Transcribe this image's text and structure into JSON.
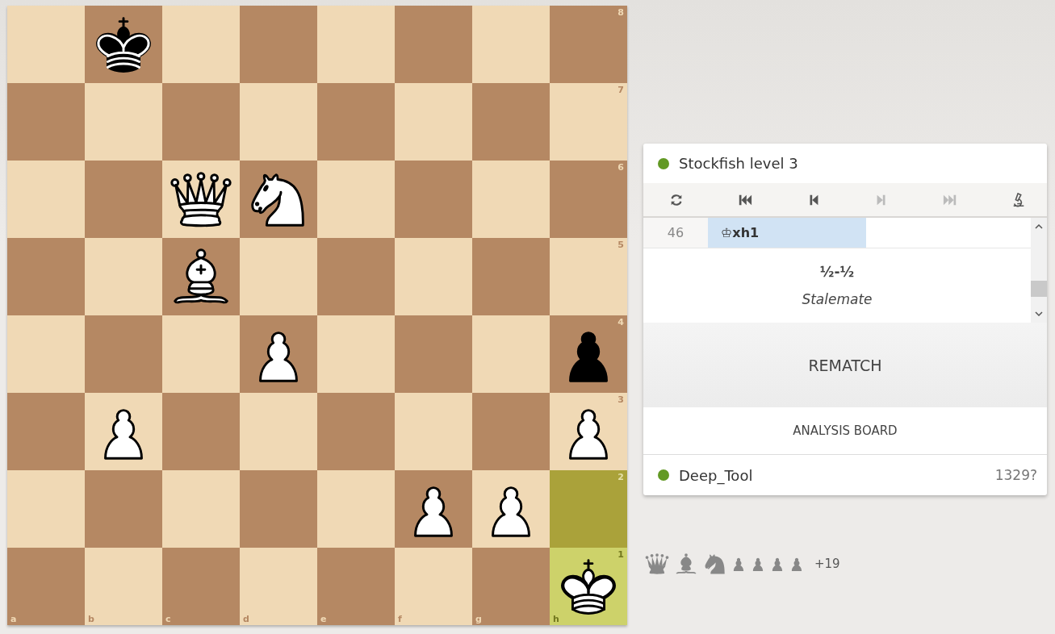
{
  "board": {
    "files": [
      "a",
      "b",
      "c",
      "d",
      "e",
      "f",
      "g",
      "h"
    ],
    "rows": [
      {
        "rank": "8",
        "squares": [
          {
            "kind": "empty",
            "highlighted": false
          },
          {
            "kind": "king",
            "black": true,
            "highlighted": false
          },
          {
            "kind": "empty",
            "highlighted": false
          },
          {
            "kind": "empty",
            "highlighted": false
          },
          {
            "kind": "empty",
            "highlighted": false
          },
          {
            "kind": "empty",
            "highlighted": false
          },
          {
            "kind": "empty",
            "highlighted": false
          },
          {
            "kind": "empty",
            "highlighted": false
          }
        ]
      },
      {
        "rank": "7",
        "squares": [
          {
            "kind": "empty",
            "highlighted": false
          },
          {
            "kind": "empty",
            "highlighted": false
          },
          {
            "kind": "empty",
            "highlighted": false
          },
          {
            "kind": "empty",
            "highlighted": false
          },
          {
            "kind": "empty",
            "highlighted": false
          },
          {
            "kind": "empty",
            "highlighted": false
          },
          {
            "kind": "empty",
            "highlighted": false
          },
          {
            "kind": "empty",
            "highlighted": false
          }
        ]
      },
      {
        "rank": "6",
        "squares": [
          {
            "kind": "empty",
            "highlighted": false
          },
          {
            "kind": "empty",
            "highlighted": false
          },
          {
            "kind": "queen",
            "black": false,
            "highlighted": false
          },
          {
            "kind": "knight",
            "black": false,
            "highlighted": false
          },
          {
            "kind": "empty",
            "highlighted": false
          },
          {
            "kind": "empty",
            "highlighted": false
          },
          {
            "kind": "empty",
            "highlighted": false
          },
          {
            "kind": "empty",
            "highlighted": false
          }
        ]
      },
      {
        "rank": "5",
        "squares": [
          {
            "kind": "empty",
            "highlighted": false
          },
          {
            "kind": "empty",
            "highlighted": false
          },
          {
            "kind": "bishop",
            "black": false,
            "highlighted": false
          },
          {
            "kind": "empty",
            "highlighted": false
          },
          {
            "kind": "empty",
            "highlighted": false
          },
          {
            "kind": "empty",
            "highlighted": false
          },
          {
            "kind": "empty",
            "highlighted": false
          },
          {
            "kind": "empty",
            "highlighted": false
          }
        ]
      },
      {
        "rank": "4",
        "squares": [
          {
            "kind": "empty",
            "highlighted": false
          },
          {
            "kind": "empty",
            "highlighted": false
          },
          {
            "kind": "empty",
            "highlighted": false
          },
          {
            "kind": "pawn",
            "black": false,
            "highlighted": false
          },
          {
            "kind": "empty",
            "highlighted": false
          },
          {
            "kind": "empty",
            "highlighted": false
          },
          {
            "kind": "empty",
            "highlighted": false
          },
          {
            "kind": "pawn",
            "black": true,
            "highlighted": false
          }
        ]
      },
      {
        "rank": "3",
        "squares": [
          {
            "kind": "empty",
            "highlighted": false
          },
          {
            "kind": "pawn",
            "black": false,
            "highlighted": false
          },
          {
            "kind": "empty",
            "highlighted": false
          },
          {
            "kind": "empty",
            "highlighted": false
          },
          {
            "kind": "empty",
            "highlighted": false
          },
          {
            "kind": "empty",
            "highlighted": false
          },
          {
            "kind": "empty",
            "highlighted": false
          },
          {
            "kind": "pawn",
            "black": false,
            "highlighted": false
          }
        ]
      },
      {
        "rank": "2",
        "squares": [
          {
            "kind": "empty",
            "highlighted": false
          },
          {
            "kind": "empty",
            "highlighted": false
          },
          {
            "kind": "empty",
            "highlighted": false
          },
          {
            "kind": "empty",
            "highlighted": false
          },
          {
            "kind": "empty",
            "highlighted": false
          },
          {
            "kind": "pawn",
            "black": false,
            "highlighted": false
          },
          {
            "kind": "pawn",
            "black": false,
            "highlighted": false
          },
          {
            "kind": "empty",
            "highlighted": true
          }
        ]
      },
      {
        "rank": "1",
        "squares": [
          {
            "kind": "empty",
            "highlighted": false
          },
          {
            "kind": "empty",
            "highlighted": false
          },
          {
            "kind": "empty",
            "highlighted": false
          },
          {
            "kind": "empty",
            "highlighted": false
          },
          {
            "kind": "empty",
            "highlighted": false
          },
          {
            "kind": "empty",
            "highlighted": false
          },
          {
            "kind": "empty",
            "highlighted": false
          },
          {
            "kind": "king",
            "black": false,
            "highlighted": true
          }
        ]
      }
    ]
  },
  "opponent": {
    "name": "Stockfish level 3",
    "online": true
  },
  "controls": [
    {
      "kind": "flip",
      "disabled": false
    },
    {
      "kind": "first",
      "disabled": false
    },
    {
      "kind": "prev",
      "disabled": false
    },
    {
      "kind": "next",
      "disabled": true
    },
    {
      "kind": "last",
      "disabled": true
    },
    {
      "kind": "analysis",
      "disabled": false
    }
  ],
  "moves": [
    {
      "number": "46",
      "plies": [
        {
          "san": "♔xh1",
          "selected": true
        }
      ]
    }
  ],
  "result": {
    "score": "½-½",
    "reason": "Stalemate"
  },
  "buttons": {
    "rematch": "REMATCH",
    "analysis": "ANALYSIS BOARD"
  },
  "player": {
    "name": "Deep_Tool",
    "online": true,
    "rating": "1329?"
  },
  "captured": {
    "pieces": [
      {
        "kind": "queen"
      },
      {
        "kind": "bishop"
      },
      {
        "kind": "knight"
      },
      {
        "kind": "pawn"
      },
      {
        "kind": "pawn"
      },
      {
        "kind": "pawn"
      },
      {
        "kind": "pawn"
      }
    ],
    "score": "+19"
  }
}
